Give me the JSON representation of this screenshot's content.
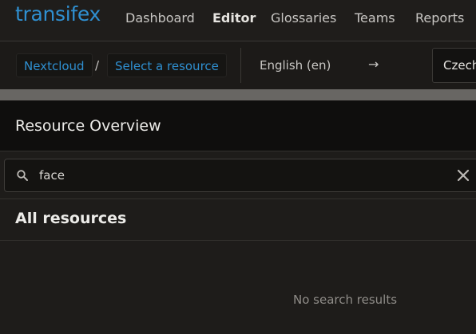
{
  "app": {
    "logo_text": "transifex",
    "brand_color": "#2f8fd0"
  },
  "nav": {
    "items": [
      {
        "label": "Dashboard",
        "active": false
      },
      {
        "label": "Editor",
        "active": true
      },
      {
        "label": "Glossaries",
        "active": false
      },
      {
        "label": "Teams",
        "active": false
      },
      {
        "label": "Reports",
        "active": false
      }
    ]
  },
  "breadcrumb": {
    "project": "Nextcloud",
    "separator": "/",
    "resource": "Select a resource"
  },
  "language": {
    "source": "English (en)",
    "arrow": "→",
    "target": "Czech"
  },
  "overview": {
    "title": "Resource Overview"
  },
  "search": {
    "value": "face",
    "icon": "search-icon",
    "clear_icon": "close-icon"
  },
  "resources": {
    "heading": "All resources",
    "empty_message": "No search results"
  }
}
